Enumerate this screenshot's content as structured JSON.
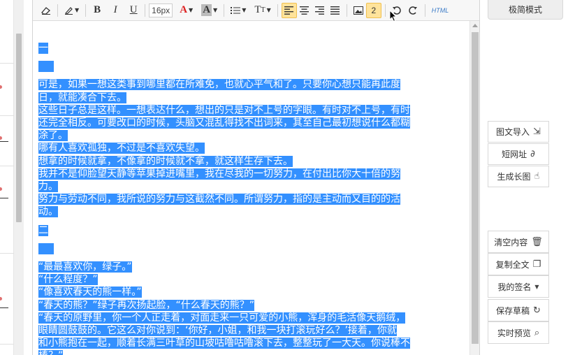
{
  "toolbar": {
    "font_size": "16px",
    "html_label": "HTML",
    "count_badge": "2"
  },
  "mode_button": "极简模式",
  "content": {
    "heading1": "一",
    "para1": [
      "可是，如果一想这类事到哪里都在所难免，也就心平气和了。只要你心想只能再此度",
      "日，就能凑合下去。",
      "这些日子总是这样。一想表达什么，想出的只是对不上号的字眼。有时对不上号，有时",
      "还完全相反。可要改口的时候，头脑又混乱得找不出词来，其至自己最初想说什么都糊",
      "涂了。",
      "哪有人喜欢孤独，不过是不喜欢失望。",
      "想拿的时候就拿，不像拿的时候就不拿，就这样生存下去。",
      "我并不是仰脸望天静等苹果掉进嘴里，我在尽我的一切努力，在付出比你大十倍的努",
      "力。",
      "努力与劳动不同，我所说的努力与这截然不同。所谓努力，指的是主动而又目的的活",
      "动。"
    ],
    "heading2": "二",
    "para2": [
      "“最最喜欢你，绿子。”",
      "“什么程度？”",
      "“像喜欢春天的熊一样。”",
      "“春天的熊？”绿子再次扬起脸，“什么春天的熊？”",
      "“春天的原野里，你一个人正走着，对面走来一只可爱的小熊，浑身的毛活像天鹅绒，",
      "眼睛圆鼓鼓的。它这么对你说到：‘你好，小姐，和我一块打滚玩好么？’接着，你就",
      "和小熊抱在一起，顺着长满三叶草的山坡咕噜咕噜滚下去，整整玩了一大天。你说棒不",
      "棒？”"
    ]
  },
  "side_buttons": [
    {
      "label": "图文导入",
      "icon": "import-icon"
    },
    {
      "label": "短网址",
      "icon": "link-icon"
    },
    {
      "label": "生成长图",
      "icon": "hand-pointer-icon"
    },
    {
      "label": "清空内容",
      "icon": "trash-icon"
    },
    {
      "label": "复制全文",
      "icon": "copy-icon"
    },
    {
      "label": "我的签名",
      "icon": "dropdown-caret-icon"
    },
    {
      "label": "保存草稿",
      "icon": "refresh-icon"
    },
    {
      "label": "实时预览",
      "icon": "preview-icon"
    }
  ],
  "colors": {
    "selection": "#3390ff",
    "active_button": "#ffe39b",
    "html_link": "#3b7bc7"
  }
}
